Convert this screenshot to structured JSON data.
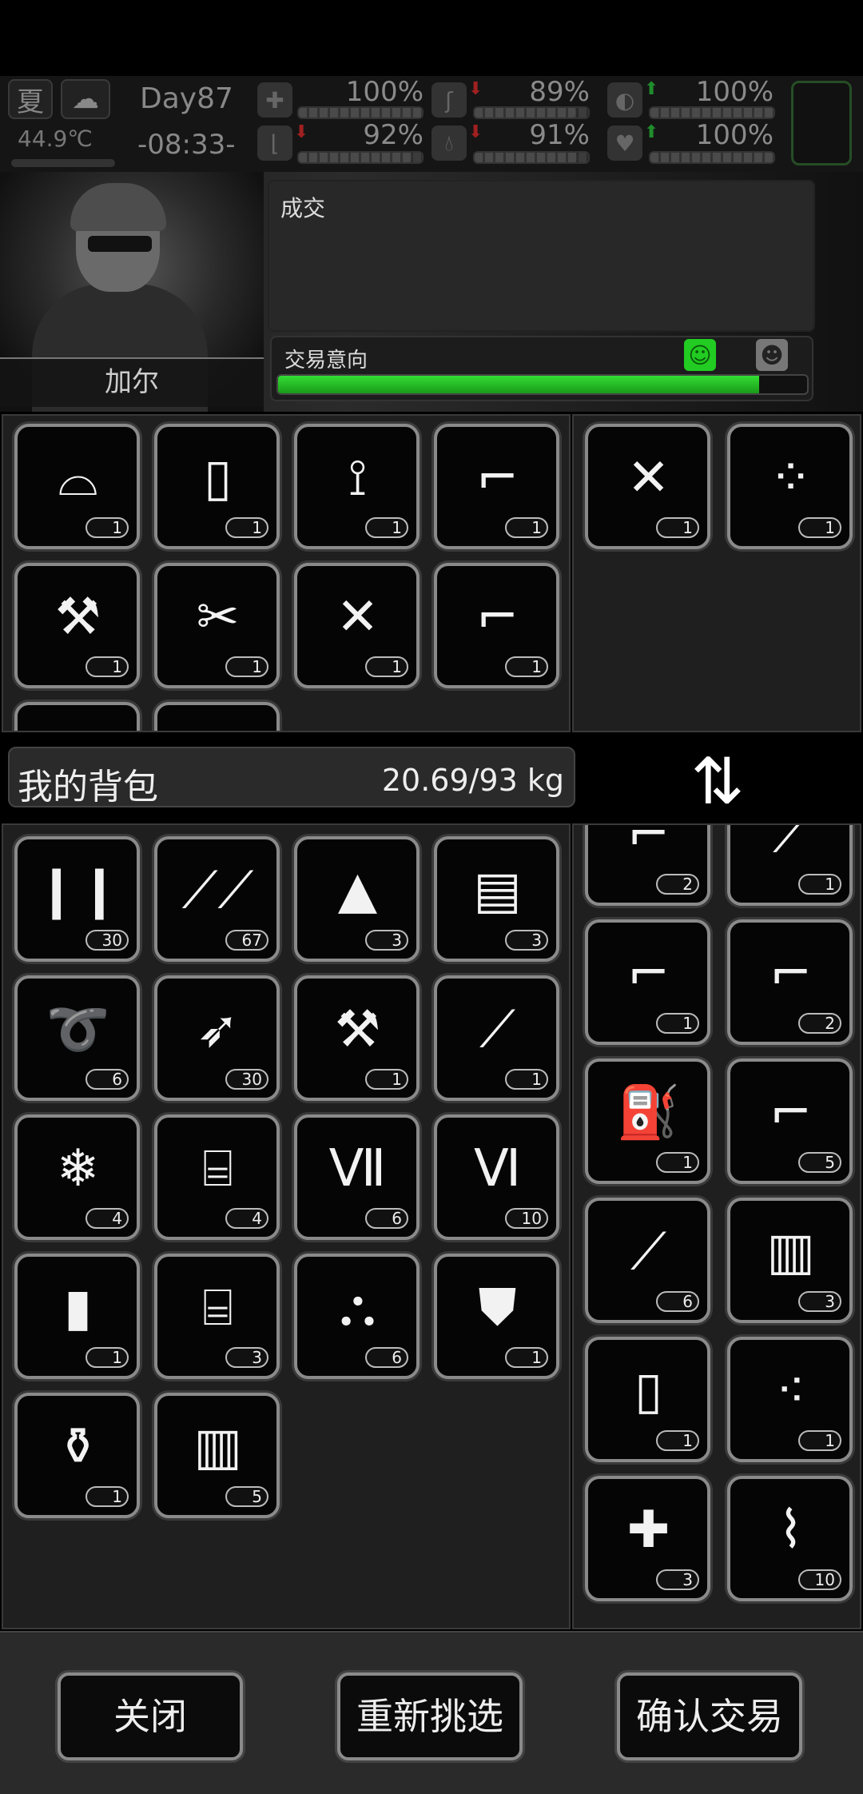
{
  "status": {
    "season": "夏",
    "weather_icon": "cloud-icon",
    "temperature": "44.9℃",
    "day": "Day87",
    "time": "-08:33-",
    "stats": [
      {
        "icon": "medkit-icon",
        "value": "100%",
        "level": 1.0
      },
      {
        "icon": "stomach-icon",
        "value": "89%",
        "level": 0.89,
        "trend": "down"
      },
      {
        "icon": "pill-icon",
        "value": "100%",
        "level": 1.0,
        "trend": "up"
      },
      {
        "icon": "boot-icon",
        "value": "92%",
        "level": 0.92,
        "trend": "down"
      },
      {
        "icon": "water-drop-icon",
        "value": "91%",
        "level": 0.91,
        "trend": "down"
      },
      {
        "icon": "heart-icon",
        "value": "100%",
        "level": 1.0,
        "trend": "up"
      }
    ]
  },
  "npc": {
    "name": "加尔",
    "dialog": "成交",
    "intent_label": "交易意向",
    "intent_level": 0.91,
    "colors": {
      "intent": "#22cc22",
      "happy_face": "#22cc22"
    }
  },
  "trade_left": [
    {
      "icon": "frying-pan-lid-icon",
      "glyph": "⌓",
      "count": "1"
    },
    {
      "icon": "cardboard-icon",
      "glyph": "▯",
      "count": "1"
    },
    {
      "icon": "folding-chair-icon",
      "glyph": "⟟",
      "count": "1"
    },
    {
      "icon": "revolver-icon",
      "glyph": "⌐",
      "count": "1"
    },
    {
      "icon": "axe-icon",
      "glyph": "⚒",
      "count": "1"
    },
    {
      "icon": "folding-knife-icon",
      "glyph": "✂",
      "count": "1"
    },
    {
      "icon": "assault-rifle-icon",
      "glyph": "✕",
      "count": "1"
    },
    {
      "icon": "desert-eagle-icon",
      "glyph": "⌐",
      "count": "1"
    },
    {
      "icon": "item-icon",
      "glyph": "",
      "count": ""
    },
    {
      "icon": "item-icon",
      "glyph": "",
      "count": ""
    }
  ],
  "trade_right": [
    {
      "icon": "m16-rifle-icon",
      "glyph": "✕",
      "count": "1"
    },
    {
      "icon": "riot-shield-icon",
      "glyph": "⁘",
      "count": "1"
    }
  ],
  "bag": {
    "title": "我的背包",
    "weight": "20.69/93 kg",
    "swap_icon": "swap-icon",
    "items": [
      {
        "icon": "bullets-icon",
        "glyph": "❙❙",
        "count": "30"
      },
      {
        "icon": "nails-icon",
        "glyph": "⟋⟋",
        "count": "67"
      },
      {
        "icon": "bandage-icon",
        "glyph": "▲",
        "count": "3"
      },
      {
        "icon": "towel-icon",
        "glyph": "▤",
        "count": "3"
      },
      {
        "icon": "rope-icon",
        "glyph": "➰",
        "count": "6"
      },
      {
        "icon": "arrow-icon",
        "glyph": "➶",
        "count": "30"
      },
      {
        "icon": "hatchet-icon",
        "glyph": "⚒",
        "count": "1"
      },
      {
        "icon": "shovel-icon",
        "glyph": "⟋",
        "count": "1"
      },
      {
        "icon": "ice-icon",
        "glyph": "❄",
        "count": "4"
      },
      {
        "icon": "toolbox-icon",
        "glyph": "⌸",
        "count": "4"
      },
      {
        "icon": "test-tube-vii-icon",
        "glyph": "Ⅶ",
        "count": "6"
      },
      {
        "icon": "test-tube-vi-icon",
        "glyph": "Ⅵ",
        "count": "10"
      },
      {
        "icon": "grenade-icon",
        "glyph": "▮",
        "count": "1"
      },
      {
        "icon": "repair-kit-icon",
        "glyph": "⌸",
        "count": "3"
      },
      {
        "icon": "lanterns-icon",
        "glyph": "⛬",
        "count": "6"
      },
      {
        "icon": "jacket-icon",
        "glyph": "⛊",
        "count": "1"
      },
      {
        "icon": "pill-bottle-spill-icon",
        "glyph": "⚱",
        "count": "1"
      },
      {
        "icon": "jar-icon",
        "glyph": "▥",
        "count": "5"
      }
    ]
  },
  "bag_right": [
    {
      "icon": "pistol-icon",
      "glyph": "⌐",
      "count": "2"
    },
    {
      "icon": "shotgun-icon",
      "glyph": "⟋",
      "count": "1"
    },
    {
      "icon": "revolver-icon",
      "glyph": "⌐",
      "count": "1"
    },
    {
      "icon": "revolver-icon",
      "glyph": "⌐",
      "count": "2"
    },
    {
      "icon": "flamethrower-icon",
      "glyph": "⛽",
      "count": "1"
    },
    {
      "icon": "desert-eagle-icon",
      "glyph": "⌐",
      "count": "5"
    },
    {
      "icon": "flashlight-icon",
      "glyph": "⟋",
      "count": "6"
    },
    {
      "icon": "jar-icon",
      "glyph": "▥",
      "count": "3"
    },
    {
      "icon": "bottle-icon",
      "glyph": "▯",
      "count": "1"
    },
    {
      "icon": "pills-icon",
      "glyph": "⁖",
      "count": "1"
    },
    {
      "icon": "syringe-icon",
      "glyph": "✚",
      "count": "3"
    },
    {
      "icon": "paper-rolls-icon",
      "glyph": "⌇",
      "count": "10"
    }
  ],
  "buttons": {
    "close": "关闭",
    "reselect": "重新挑选",
    "confirm": "确认交易"
  }
}
